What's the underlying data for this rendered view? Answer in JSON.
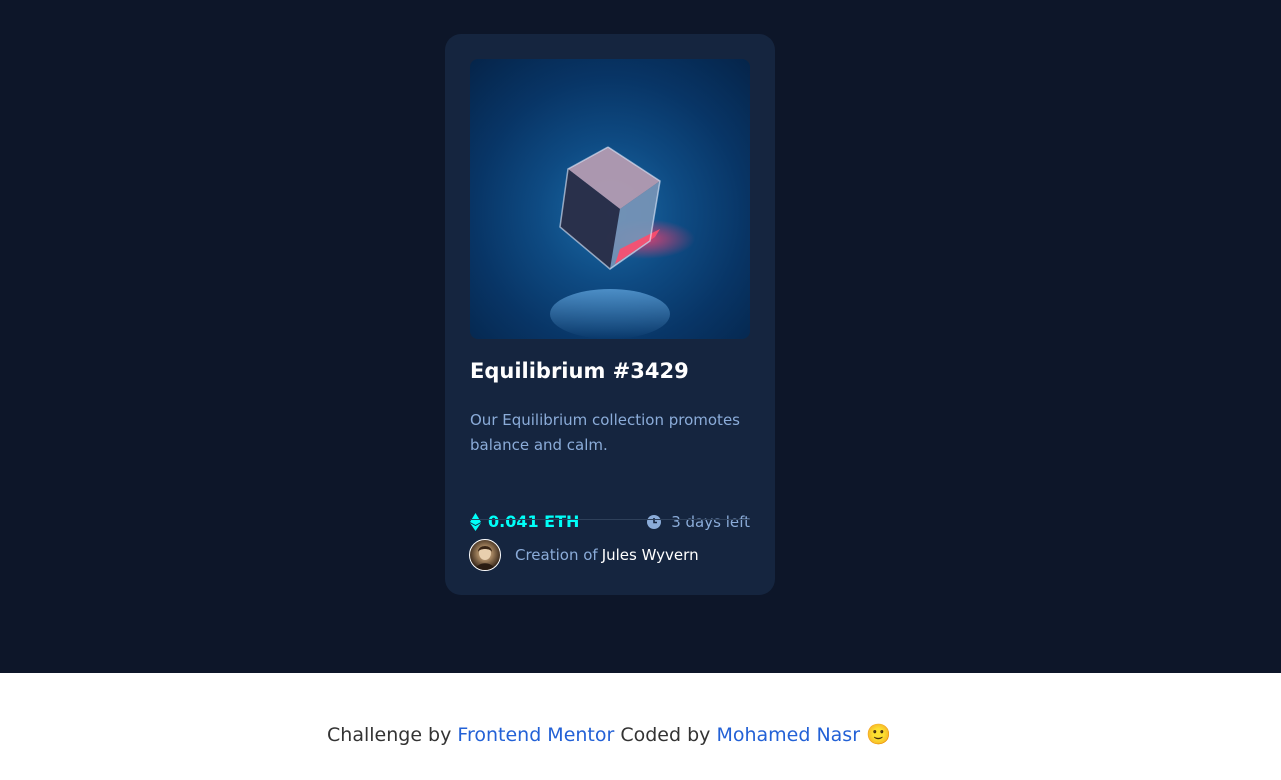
{
  "card": {
    "title": "Equilibrium #3429",
    "description": "Our Equilibrium collection promotes balance and calm.",
    "price": "0.041 ETH",
    "time_left": "3 days left",
    "creation_label": "Creation of",
    "creator_name": "Jules Wyvern",
    "icons": [
      "ethereum-icon",
      "clock-icon"
    ]
  },
  "footer": {
    "challenge_by": "Challenge by",
    "frontend_mentor": "Frontend Mentor",
    "coded_by": "Coded by",
    "author": "Mohamed Nasr",
    "emoji": "🙂"
  },
  "colors": {
    "page_background": "#0d1629",
    "card_background": "#15253f",
    "accent_cyan": "#00fff8",
    "soft_blue": "#8bacd9",
    "link_blue": "#2361d6"
  }
}
